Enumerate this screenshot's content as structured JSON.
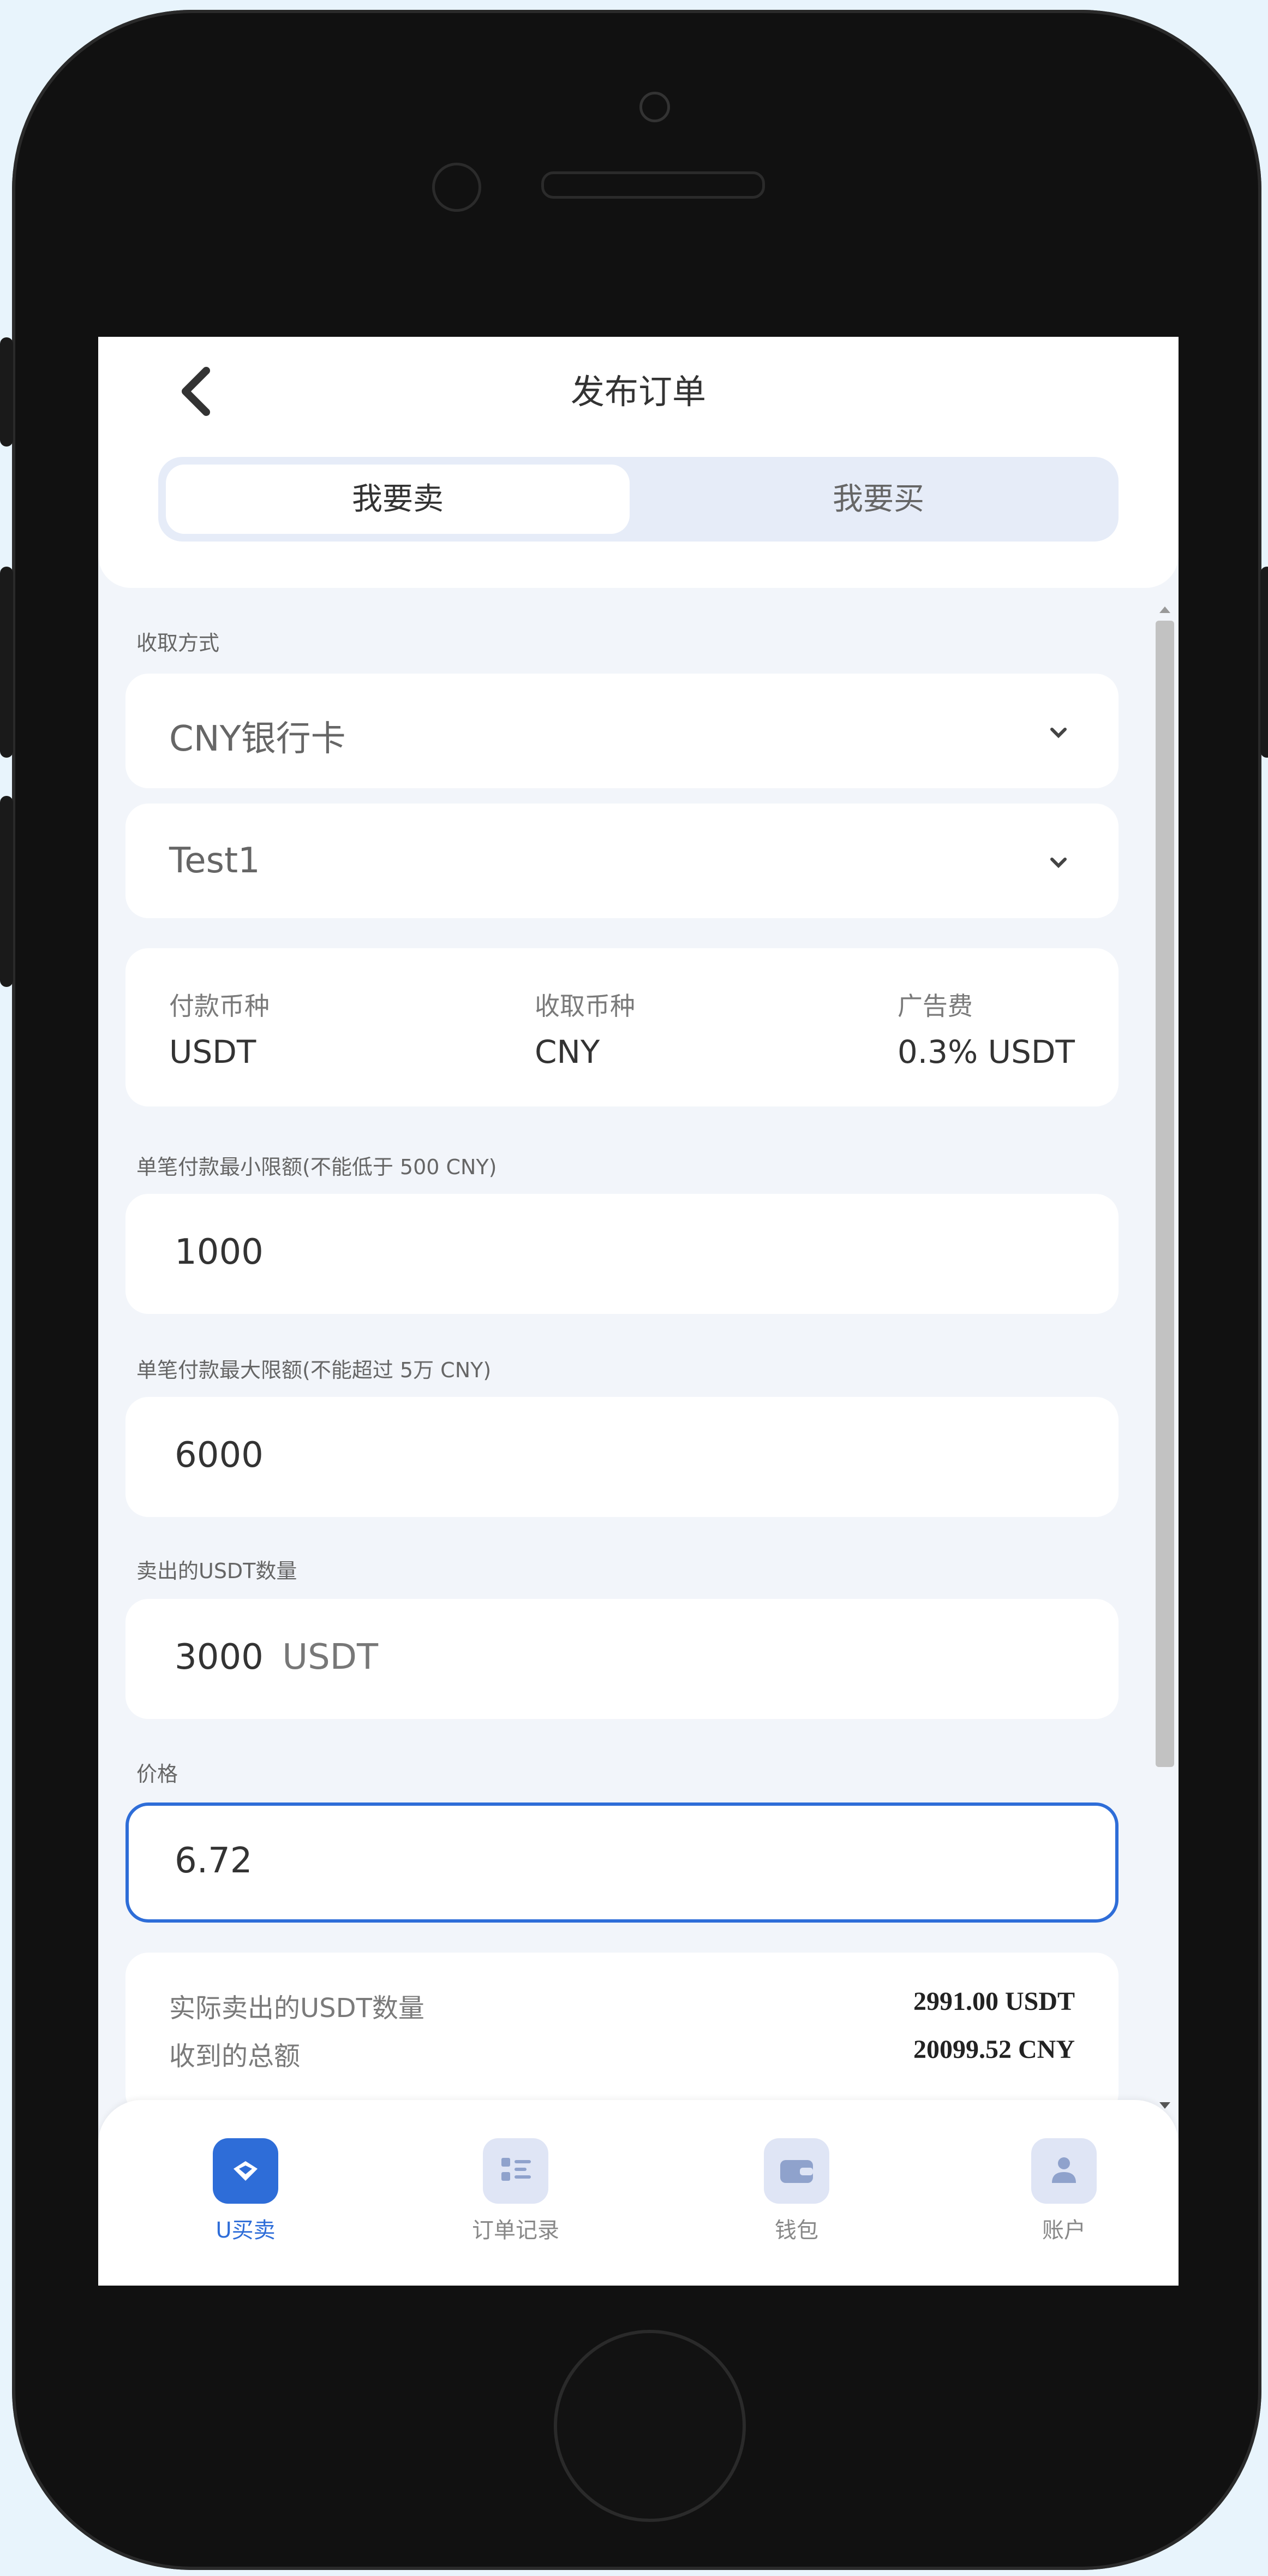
{
  "header": {
    "title": "发布订单",
    "segment": {
      "active": "我要卖",
      "inactive": "我要买"
    }
  },
  "receive_method": {
    "label": "收取方式",
    "select1": "CNY银行卡",
    "select2": "Test1"
  },
  "info": {
    "pay_currency_label": "付款币种",
    "pay_currency_value": "USDT",
    "receive_currency_label": "收取币种",
    "receive_currency_value": "CNY",
    "ad_fee_label": "广告费",
    "ad_fee_value": "0.3% USDT"
  },
  "min_limit": {
    "label": "单笔付款最小限额(不能低于 500 CNY)",
    "value": "1000"
  },
  "max_limit": {
    "label": "单笔付款最大限额(不能超过 5万 CNY)",
    "value": "6000"
  },
  "sell_amount": {
    "label": "卖出的USDT数量",
    "value": "3000",
    "unit": "USDT"
  },
  "price": {
    "label": "价格",
    "value": "6.72"
  },
  "summary": {
    "actual_label": "实际卖出的USDT数量",
    "actual_value": "2991.00 USDT",
    "total_label": "收到的总额",
    "total_value": "20099.52 CNY"
  },
  "tabs": [
    {
      "label": "U买卖",
      "icon": "trade-icon",
      "active": true
    },
    {
      "label": "订单记录",
      "icon": "orders-icon",
      "active": false
    },
    {
      "label": "钱包",
      "icon": "wallet-icon",
      "active": false
    },
    {
      "label": "账户",
      "icon": "account-icon",
      "active": false
    }
  ],
  "colors": {
    "accent": "#2e6dd8",
    "background": "#f2f5fa",
    "page_bg": "#e8f4fc"
  }
}
